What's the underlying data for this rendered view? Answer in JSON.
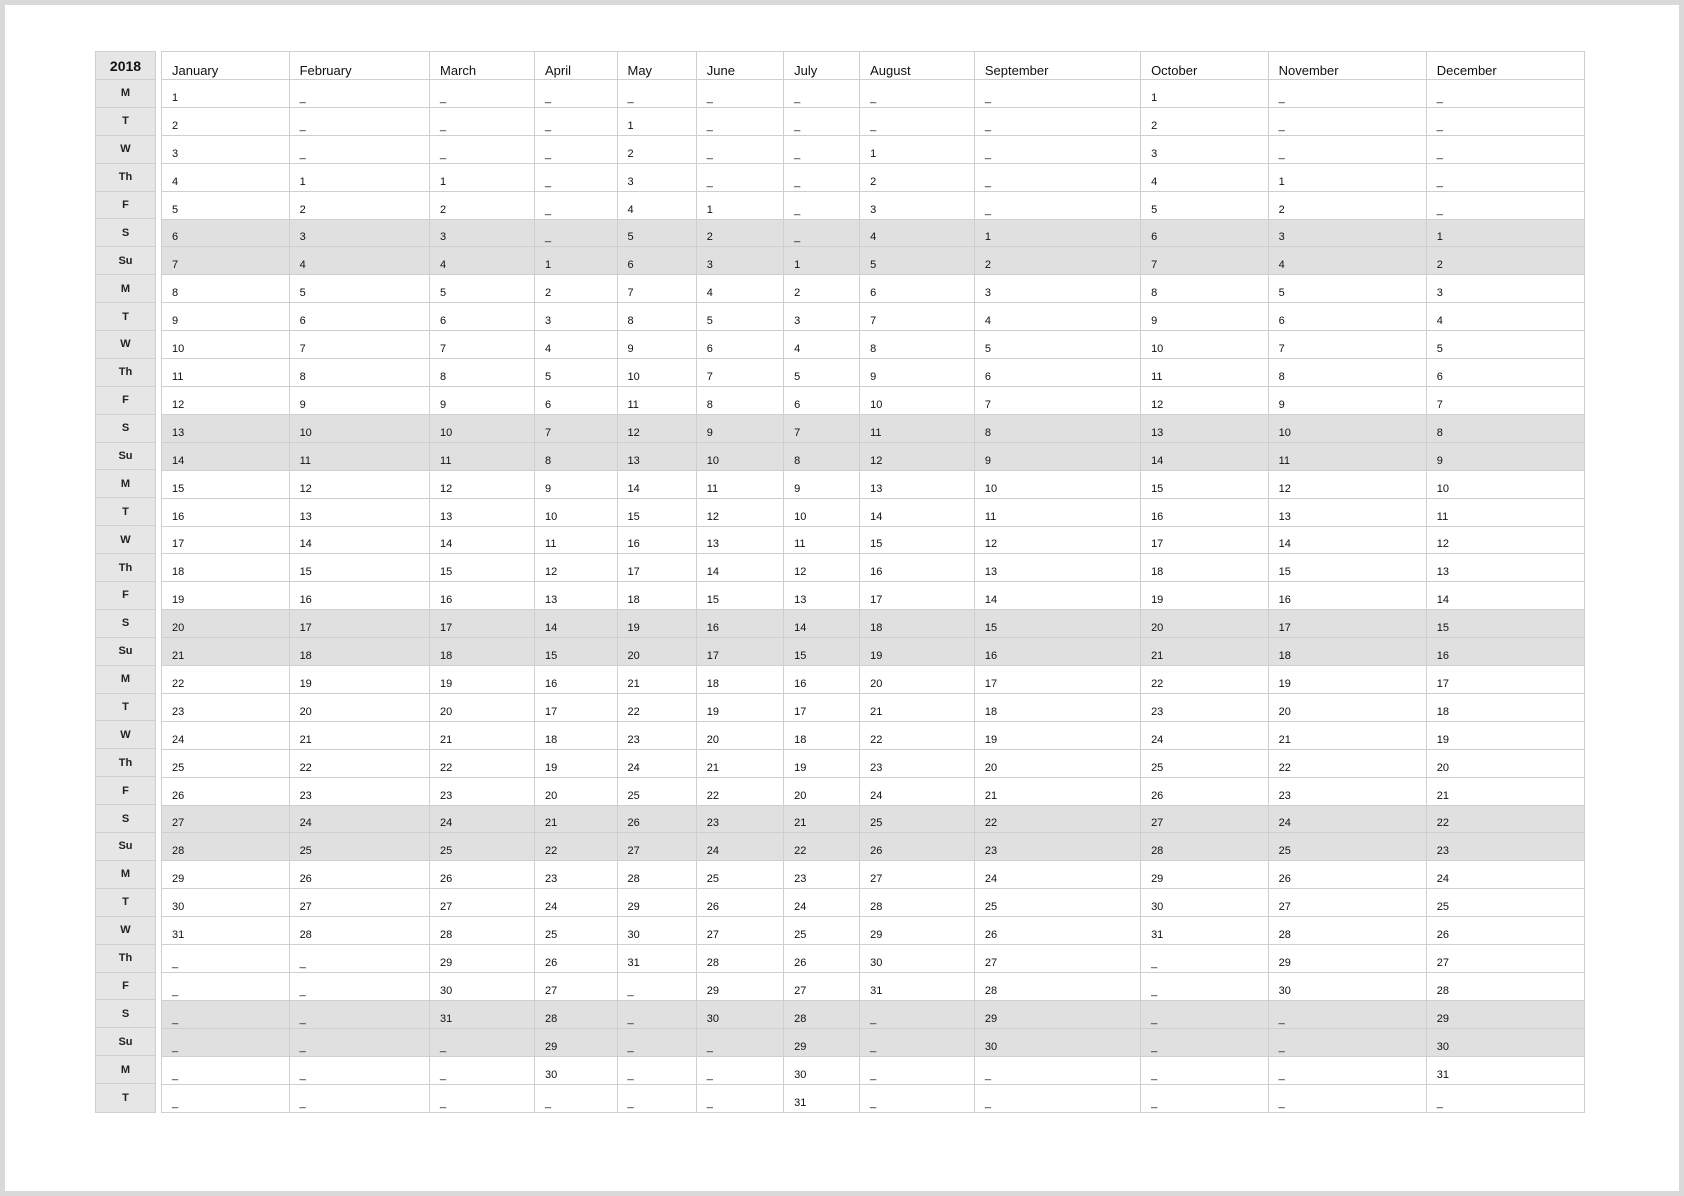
{
  "year": "2018",
  "months": [
    "January",
    "February",
    "March",
    "April",
    "May",
    "June",
    "July",
    "August",
    "September",
    "October",
    "November",
    "December"
  ],
  "start_weekday": [
    0,
    3,
    3,
    6,
    1,
    4,
    6,
    2,
    5,
    0,
    3,
    5
  ],
  "month_days": [
    31,
    28,
    31,
    30,
    31,
    30,
    31,
    31,
    30,
    31,
    30,
    31
  ],
  "weekday_labels": [
    "M",
    "T",
    "W",
    "Th",
    "F",
    "S",
    "Su"
  ],
  "placeholder": "_",
  "colors": {
    "weekend_shading": "#e0e0e0",
    "grid_line": "#cfcfcf"
  }
}
